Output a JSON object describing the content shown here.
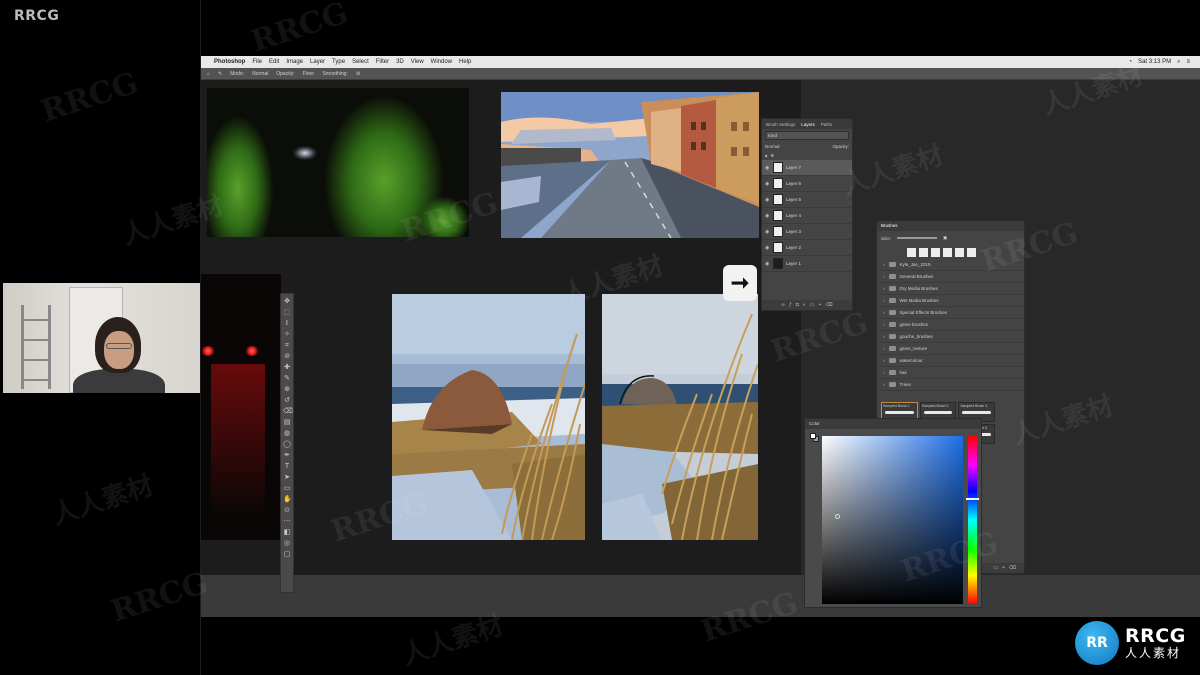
{
  "overlay": {
    "brand": "RRCG",
    "watermark_en": "RRCG",
    "watermark_cn": "人人素材"
  },
  "menubar": {
    "app": "Photoshop",
    "items": [
      "File",
      "Edit",
      "Image",
      "Layer",
      "Type",
      "Select",
      "Filter",
      "3D",
      "View",
      "Window",
      "Help"
    ],
    "clock": "Sat 3:13 PM"
  },
  "options_bar": {
    "mode_label": "Mode:",
    "mode_value": "Normal",
    "opacity_label": "Opacity:",
    "flow_label": "Flow:",
    "smoothing_label": "Smoothing:"
  },
  "layers_panel": {
    "tabs": [
      "Brush Settings",
      "Layers",
      "Paths"
    ],
    "active_tab": "Layers",
    "filter_placeholder": "Kind",
    "blend_mode": "Normal",
    "opacity_label": "Opacity:",
    "layers": [
      {
        "name": "Layer 7",
        "selected": true,
        "dark": false
      },
      {
        "name": "Layer 6",
        "selected": false,
        "dark": false
      },
      {
        "name": "Layer 5",
        "selected": false,
        "dark": false
      },
      {
        "name": "Layer 4",
        "selected": false,
        "dark": false
      },
      {
        "name": "Layer 3",
        "selected": false,
        "dark": false
      },
      {
        "name": "Layer 2",
        "selected": false,
        "dark": false
      },
      {
        "name": "Layer 1",
        "selected": false,
        "dark": true
      }
    ]
  },
  "brushes_panel": {
    "title": "Brushes",
    "size_label": "Size:",
    "folders": [
      "Kyle_Jan_2019",
      "General Brushes",
      "Dry Media Brushes",
      "Wet Media Brushes",
      "Special Effects Brushes",
      "game brushes",
      "gouche_brushes",
      "game_texture",
      "watercolour",
      "hair",
      "Trees"
    ],
    "presets": [
      "Sampled Brush 1",
      "Sampled Brush 2",
      "Sampled Brush 3",
      "Sampled Brush 4",
      "Sampled Brush 5",
      "Sampled Brush 6"
    ]
  },
  "color_panel": {
    "title": "Color",
    "foreground": "#ffffff",
    "background": "#8aa0ba"
  },
  "arrow_glyph": "➞",
  "tool_icons": [
    "move-icon",
    "marquee-icon",
    "lasso-icon",
    "quick-select-icon",
    "crop-icon",
    "eyedropper-icon",
    "healing-icon",
    "brush-icon",
    "stamp-icon",
    "history-brush-icon",
    "eraser-icon",
    "gradient-icon",
    "blur-icon",
    "dodge-icon",
    "pen-icon",
    "type-icon",
    "path-select-icon",
    "shape-icon",
    "hand-icon",
    "zoom-icon",
    "more-icon",
    "fg-bg-swatch-icon",
    "quickmask-icon",
    "screen-mode-icon"
  ],
  "logo": {
    "badge": "RR",
    "name_en": "RRCG",
    "name_cn": "人人素材"
  }
}
